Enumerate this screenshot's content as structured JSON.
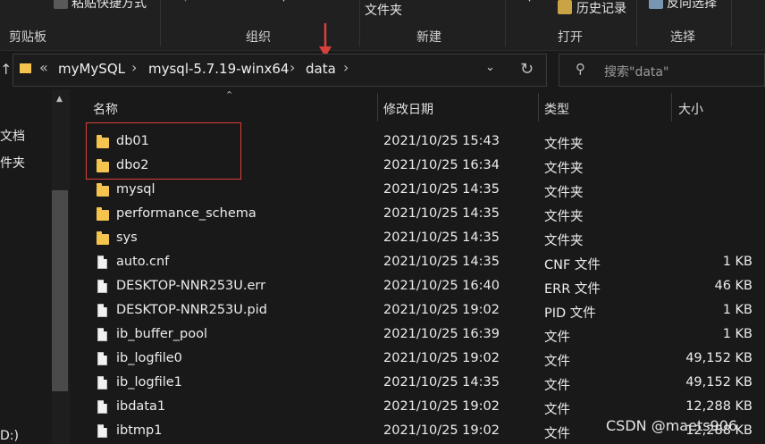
{
  "ribbon": {
    "clipboard_top": "粘贴快捷方式",
    "new_top": "文件夹",
    "open_top": "历史记录",
    "select_top": "反向选择",
    "groups": [
      "剪贴板",
      "组织",
      "新建",
      "打开",
      "选择"
    ]
  },
  "address": {
    "overflow": "«",
    "crumbs": [
      "myMySQL",
      "mysql-5.7.19-winx64",
      "data"
    ],
    "search_placeholder": "搜索\"data\""
  },
  "nav": {
    "items": [
      "文档",
      "件夹",
      "D:)"
    ]
  },
  "columns": {
    "name": "名称",
    "date": "修改日期",
    "type": "类型",
    "size": "大小"
  },
  "files": [
    {
      "name": "db01",
      "date": "2021/10/25 15:43",
      "type": "文件夹",
      "size": "",
      "kind": "folder"
    },
    {
      "name": "dbo2",
      "date": "2021/10/25 16:34",
      "type": "文件夹",
      "size": "",
      "kind": "folder"
    },
    {
      "name": "mysql",
      "date": "2021/10/25 14:35",
      "type": "文件夹",
      "size": "",
      "kind": "folder"
    },
    {
      "name": "performance_schema",
      "date": "2021/10/25 14:35",
      "type": "文件夹",
      "size": "",
      "kind": "folder"
    },
    {
      "name": "sys",
      "date": "2021/10/25 14:35",
      "type": "文件夹",
      "size": "",
      "kind": "folder"
    },
    {
      "name": "auto.cnf",
      "date": "2021/10/25 14:35",
      "type": "CNF 文件",
      "size": "1 KB",
      "kind": "file"
    },
    {
      "name": "DESKTOP-NNR253U.err",
      "date": "2021/10/25 16:40",
      "type": "ERR 文件",
      "size": "46 KB",
      "kind": "file"
    },
    {
      "name": "DESKTOP-NNR253U.pid",
      "date": "2021/10/25 19:02",
      "type": "PID 文件",
      "size": "1 KB",
      "kind": "file"
    },
    {
      "name": "ib_buffer_pool",
      "date": "2021/10/25 16:39",
      "type": "文件",
      "size": "1 KB",
      "kind": "file"
    },
    {
      "name": "ib_logfile0",
      "date": "2021/10/25 19:02",
      "type": "文件",
      "size": "49,152 KB",
      "kind": "file"
    },
    {
      "name": "ib_logfile1",
      "date": "2021/10/25 14:35",
      "type": "文件",
      "size": "49,152 KB",
      "kind": "file"
    },
    {
      "name": "ibdata1",
      "date": "2021/10/25 19:02",
      "type": "文件",
      "size": "12,288 KB",
      "kind": "file"
    },
    {
      "name": "ibtmp1",
      "date": "2021/10/25 19:02",
      "type": "文件",
      "size": "12,288 KB",
      "kind": "file"
    }
  ],
  "watermark": "CSDN @maets906",
  "colors": {
    "folder": "#f4c44e",
    "annotation": "#d8403a",
    "background": "#191919"
  }
}
